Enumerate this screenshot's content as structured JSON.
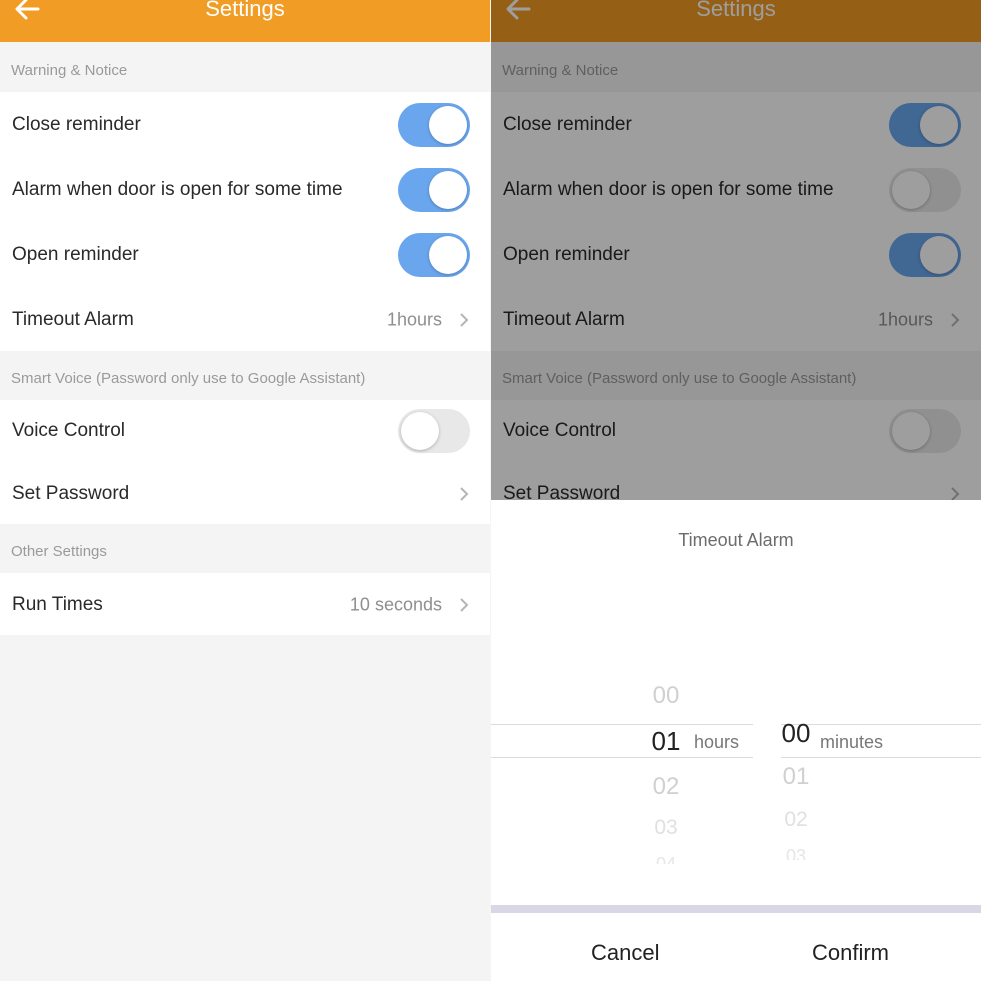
{
  "header": {
    "title": "Settings"
  },
  "sections": {
    "warning": "Warning & Notice",
    "smart_voice": "Smart Voice (Password only use to Google Assistant)",
    "other": "Other Settings"
  },
  "left": {
    "close_reminder": {
      "label": "Close reminder",
      "on": true
    },
    "alarm_open": {
      "label": "Alarm when door is open for some time",
      "on": true
    },
    "open_reminder": {
      "label": "Open reminder",
      "on": true
    },
    "timeout_alarm": {
      "label": "Timeout Alarm",
      "value": "1hours"
    },
    "voice_control": {
      "label": "Voice Control",
      "on": false
    },
    "set_password": {
      "label": "Set Password"
    },
    "run_times": {
      "label": "Run Times",
      "value": "10 seconds"
    }
  },
  "right": {
    "close_reminder": {
      "label": "Close reminder",
      "on": true
    },
    "alarm_open": {
      "label": "Alarm when door is open for some time",
      "on": false
    },
    "open_reminder": {
      "label": "Open reminder",
      "on": true
    },
    "timeout_alarm": {
      "label": "Timeout Alarm",
      "value": "1hours"
    },
    "voice_control": {
      "label": "Voice Control",
      "on": false
    },
    "set_password": {
      "label": "Set Password"
    }
  },
  "dialog": {
    "title": "Timeout Alarm",
    "hours": {
      "above": "00",
      "selected": "01",
      "below1": "02",
      "below2": "03",
      "below3": "04",
      "unit": "hours"
    },
    "minutes": {
      "selected": "00",
      "below1": "01",
      "below2": "02",
      "below3": "03",
      "unit": "minutes"
    },
    "cancel": "Cancel",
    "confirm": "Confirm"
  },
  "colors": {
    "header": "#f19c24",
    "toggle_on": "#6aa6ee",
    "toggle_off": "#e8e8e8"
  }
}
